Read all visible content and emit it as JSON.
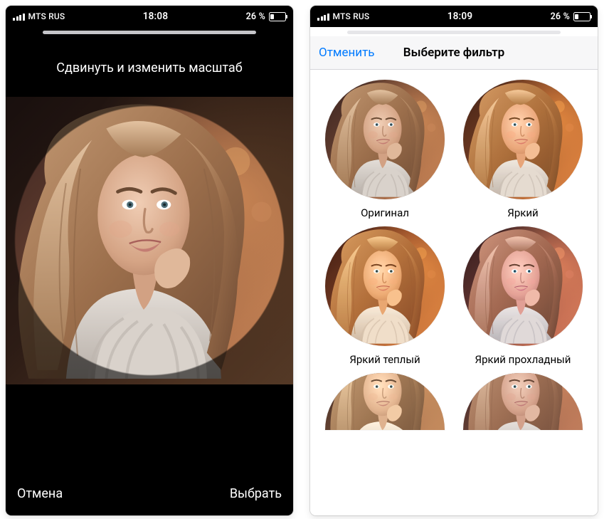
{
  "left": {
    "status": {
      "carrier": "MTS RUS",
      "time": "18:08",
      "battery_text": "26 %",
      "battery_pct": 26
    },
    "title": "Сдвинуть и изменить масштаб",
    "cancel": "Отмена",
    "choose": "Выбрать"
  },
  "right": {
    "status": {
      "carrier": "MTS RUS",
      "time": "18:09",
      "battery_text": "26 %",
      "battery_pct": 26
    },
    "header": {
      "cancel": "Отменить",
      "title": "Выберите фильтр"
    },
    "filters": [
      {
        "label": "Оригинал"
      },
      {
        "label": "Яркий"
      },
      {
        "label": "Яркий теплый"
      },
      {
        "label": "Яркий прохладный"
      },
      {
        "label": ""
      },
      {
        "label": ""
      }
    ]
  }
}
